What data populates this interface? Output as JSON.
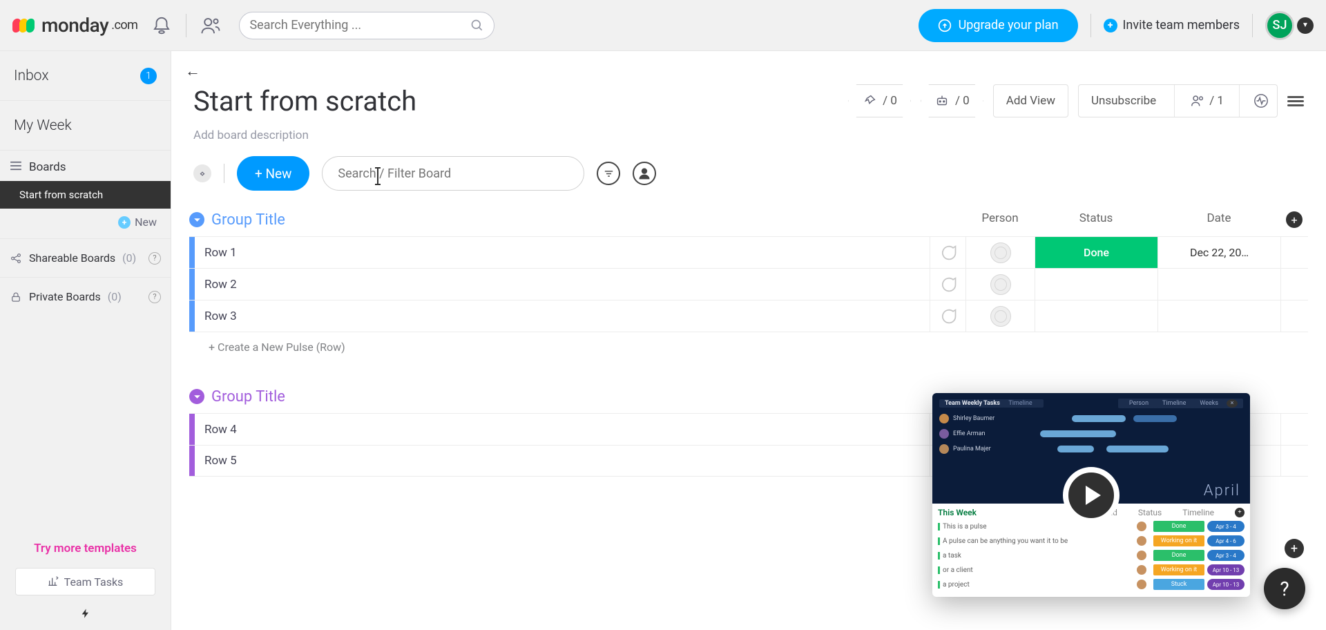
{
  "brand": {
    "name": "monday",
    "suffix": ".com"
  },
  "topbar": {
    "search_placeholder": "Search Everything ...",
    "upgrade": "Upgrade your plan",
    "invite": "Invite team members",
    "avatar_initials": "SJ"
  },
  "sidebar": {
    "inbox": {
      "label": "Inbox",
      "badge": "1"
    },
    "myweek": {
      "label": "My Week"
    },
    "boards_header": "Boards",
    "boards": [
      {
        "label": "Start from scratch",
        "active": true
      }
    ],
    "new_board": "New",
    "shareable": {
      "label": "Shareable Boards",
      "count": "(0)"
    },
    "private": {
      "label": "Private Boards",
      "count": "(0)"
    },
    "try_more": "Try more templates",
    "template_chip": "Team Tasks"
  },
  "board": {
    "title": "Start from scratch",
    "description_placeholder": "Add board description",
    "pin_count": "/ 0",
    "bot_count": "/ 0",
    "add_view": "Add View",
    "unsubscribe": "Unsubscribe",
    "members_count": "/ 1",
    "new_button": "+ New",
    "search_placeholder": "Search / Filter Board",
    "new_row_placeholder": "+ Create a New Pulse (Row)",
    "columns": {
      "person": "Person",
      "status": "Status",
      "date": "Date"
    },
    "groups": [
      {
        "color": "blue",
        "title": "Group Title",
        "rows": [
          {
            "name": "Row 1",
            "status_label": "Done",
            "status_color": "#00c875",
            "date": "Dec 22, 20…"
          },
          {
            "name": "Row 2"
          },
          {
            "name": "Row 3"
          }
        ]
      },
      {
        "color": "purple",
        "title": "Group Title",
        "rows": [
          {
            "name": "Row 4"
          },
          {
            "name": "Row 5"
          }
        ]
      }
    ]
  },
  "video_card": {
    "header": "Team Weekly Tasks",
    "tab": "Timeline",
    "controls": [
      "Person",
      "Timeline",
      "Weeks"
    ],
    "people": [
      "Shirley Baumer",
      "Effie Arman",
      "Paulina Majer"
    ],
    "month": "April",
    "this_week": "This Week",
    "col_labels": [
      "Lead",
      "Status",
      "Timeline"
    ],
    "rows": [
      {
        "text": "This is a pulse",
        "status": "Done",
        "status_color": "#2bbf6a",
        "date": "Apr 3 - 4",
        "date_color": "#2978c8"
      },
      {
        "text": "A pulse can be anything you want it to be",
        "status": "Working on it",
        "status_color": "#f5a623",
        "date": "Apr 4 - 6",
        "date_color": "#2978c8"
      },
      {
        "text": "a task",
        "status": "Done",
        "status_color": "#2bbf6a",
        "date": "Apr 3 - 4",
        "date_color": "#2978c8"
      },
      {
        "text": "or a client",
        "status": "Working on it",
        "status_color": "#f5a623",
        "date": "Apr 10 - 13",
        "date_color": "#713eae"
      },
      {
        "text": "a project",
        "status": "Stuck",
        "status_color": "#4aa6e0",
        "date": "Apr 10 - 13",
        "date_color": "#713eae"
      }
    ]
  },
  "help_fab": "?"
}
